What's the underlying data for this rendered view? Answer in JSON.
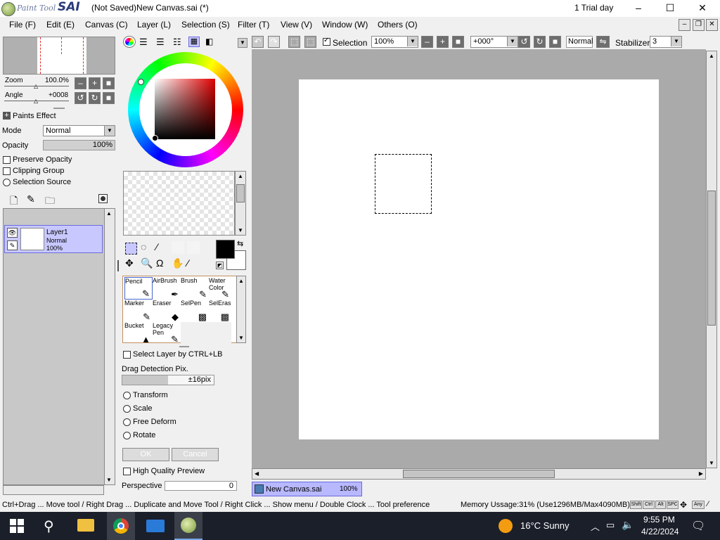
{
  "window": {
    "app_logo_small": "Paint Tool",
    "app_logo_big": "SAI",
    "title": "(Not Saved)New Canvas.sai (*)",
    "trial": "1 Trial day",
    "minimize": "–",
    "maximize": "☐",
    "close": "✕"
  },
  "menu": [
    "File (F)",
    "Edit (E)",
    "Canvas (C)",
    "Layer (L)",
    "Selection (S)",
    "Filter (T)",
    "View (V)",
    "Window (W)",
    "Others (O)"
  ],
  "navigator": {
    "zoom_label": "Zoom",
    "zoom_value": "100.0%",
    "angle_label": "Angle",
    "angle_value": "+0008"
  },
  "layer_props": {
    "paints_effect": "Paints Effect",
    "mode_label": "Mode",
    "mode_value": "Normal",
    "opacity_label": "Opacity",
    "opacity_value": "100%",
    "preserve_opacity": "Preserve Opacity",
    "clipping_group": "Clipping Group",
    "selection_source": "Selection Source"
  },
  "layer": {
    "name": "Layer1",
    "mode": "Normal",
    "opacity": "100%"
  },
  "tools": [
    {
      "label": "Pencil",
      "icon": "pencil-icon",
      "glyph": "✎"
    },
    {
      "label": "AirBrush",
      "icon": "airbrush-icon",
      "glyph": "✒"
    },
    {
      "label": "Brush",
      "icon": "brush-icon",
      "glyph": "✎"
    },
    {
      "label": "Water Color",
      "icon": "watercolor-icon",
      "glyph": "✎"
    },
    {
      "label": "Marker",
      "icon": "marker-icon",
      "glyph": "✎"
    },
    {
      "label": "Eraser",
      "icon": "eraser-icon",
      "glyph": "◆"
    },
    {
      "label": "SelPen",
      "icon": "selpen-icon",
      "glyph": "▩"
    },
    {
      "label": "SelEras",
      "icon": "seleras-icon",
      "glyph": "▩"
    },
    {
      "label": "Bucket",
      "icon": "bucket-icon",
      "glyph": "▲"
    },
    {
      "label": "Legacy Pen",
      "icon": "legacy-pen-icon",
      "glyph": "✎"
    }
  ],
  "tool_options": {
    "select_layer": "Select Layer by CTRL+LB",
    "drag_detection_label": "Drag Detection Pix.",
    "drag_detection_value": "±16pix",
    "transform": "Transform",
    "scale": "Scale",
    "free_deform": "Free Deform",
    "rotate": "Rotate",
    "ok": "OK",
    "cancel": "Cancel",
    "high_quality_preview": "High Quality Preview",
    "perspective_label": "Perspective",
    "perspective_value": "0"
  },
  "canvas_toolbar": {
    "selection_label": "Selection",
    "zoom": "100%",
    "angle": "+000°",
    "blend": "Normal",
    "stabilizer_label": "Stabilizer",
    "stabilizer_value": "3"
  },
  "canvas_tab": {
    "name": "New Canvas.sai",
    "zoom": "100%"
  },
  "status": {
    "hint": "Ctrl+Drag ... Move tool / Right Drag ... Duplicate and Move Tool / Right Click ... Show menu / Double Clock ... Tool preference",
    "memory": "Memory Ussage:31% (Use1296MB/Max4090MB)",
    "keys": [
      "Shift",
      "Ctrl",
      "Alt",
      "SPC",
      "Any"
    ]
  },
  "taskbar": {
    "weather": "16°C  Sunny",
    "time": "9:55 PM",
    "date": "4/22/2024"
  },
  "colors": {
    "primary": "#000000",
    "secondary": "#ffffff",
    "layer_highlight": "#c8c8ff",
    "tab_highlight": "#b8b8ff",
    "canvas_bg": "#aaaaaa"
  }
}
